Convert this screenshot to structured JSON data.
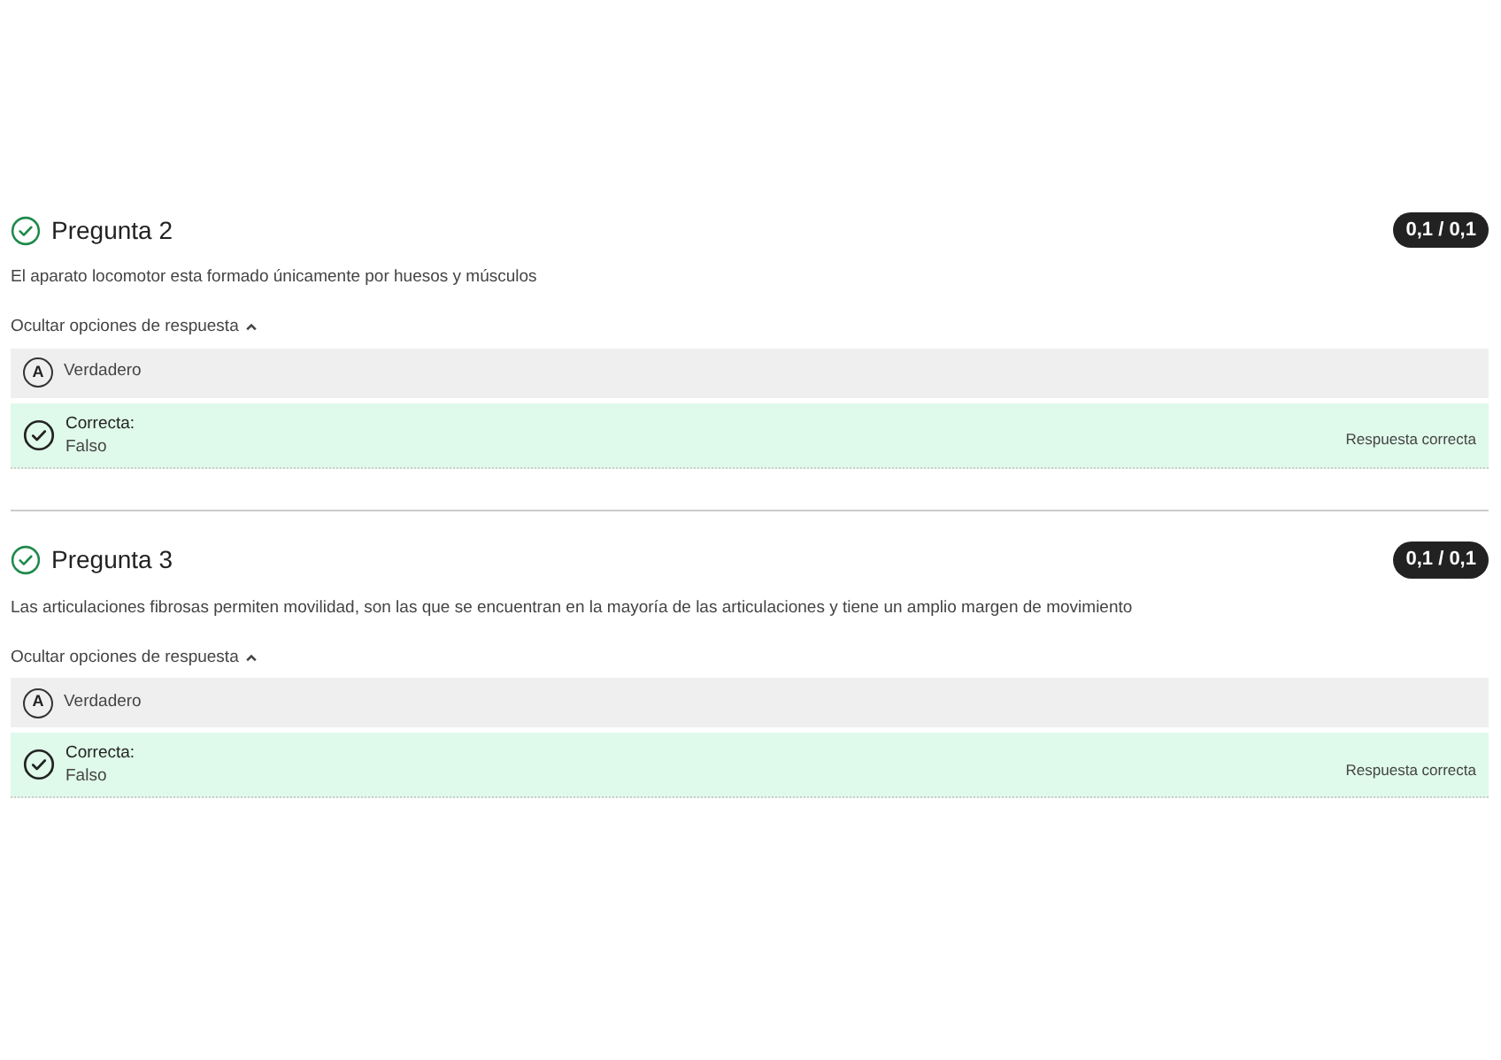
{
  "questions": [
    {
      "title": "Pregunta 2",
      "score": "0,1 / 0,1",
      "correct": true,
      "statement": "El aparato locomotor esta formado únicamente por huesos y músculos",
      "toggle": {
        "label": "Ocultar opciones de respuesta",
        "expanded": true
      },
      "options": [
        {
          "kind": "option",
          "letter": "A",
          "label": "Verdadero"
        },
        {
          "kind": "correct",
          "heading": "Correcta:",
          "label": "Falso",
          "note": "Respuesta correcta"
        }
      ]
    },
    {
      "title": "Pregunta 3",
      "score": "0,1 / 0,1",
      "correct": true,
      "statement": "Las articulaciones fibrosas permiten movilidad, son las que se encuentran en la mayoría de las articulaciones y tiene un amplio margen de movimiento",
      "toggle": {
        "label": "Ocultar opciones de respuesta",
        "expanded": true
      },
      "options": [
        {
          "kind": "option",
          "letter": "A",
          "label": "Verdadero"
        },
        {
          "kind": "correct",
          "heading": "Correcta:",
          "label": "Falso",
          "note": "Respuesta correcta"
        }
      ]
    }
  ]
}
